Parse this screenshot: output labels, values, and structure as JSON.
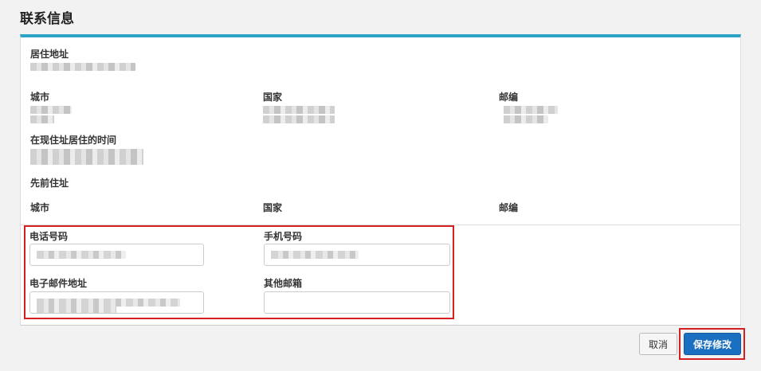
{
  "section_title": "联系信息",
  "address": {
    "residential_label": "居住地址",
    "city_label": "城市",
    "country_label": "国家",
    "postal_label": "邮编",
    "time_at_address_label": "在现住址居住的时间",
    "previous_address_label": "先前住址",
    "prev_city_label": "城市",
    "prev_country_label": "国家",
    "prev_postal_label": "邮编"
  },
  "contact": {
    "phone_label": "电话号码",
    "mobile_label": "手机号码",
    "email_label": "电子邮件地址",
    "other_email_label": "其他邮箱",
    "other_email_value": ""
  },
  "actions": {
    "cancel_label": "取消",
    "save_label": "保存修改"
  },
  "colors": {
    "accent_bar": "#2ea3c8",
    "primary_button": "#1a6fc0",
    "highlight": "#d42020"
  }
}
